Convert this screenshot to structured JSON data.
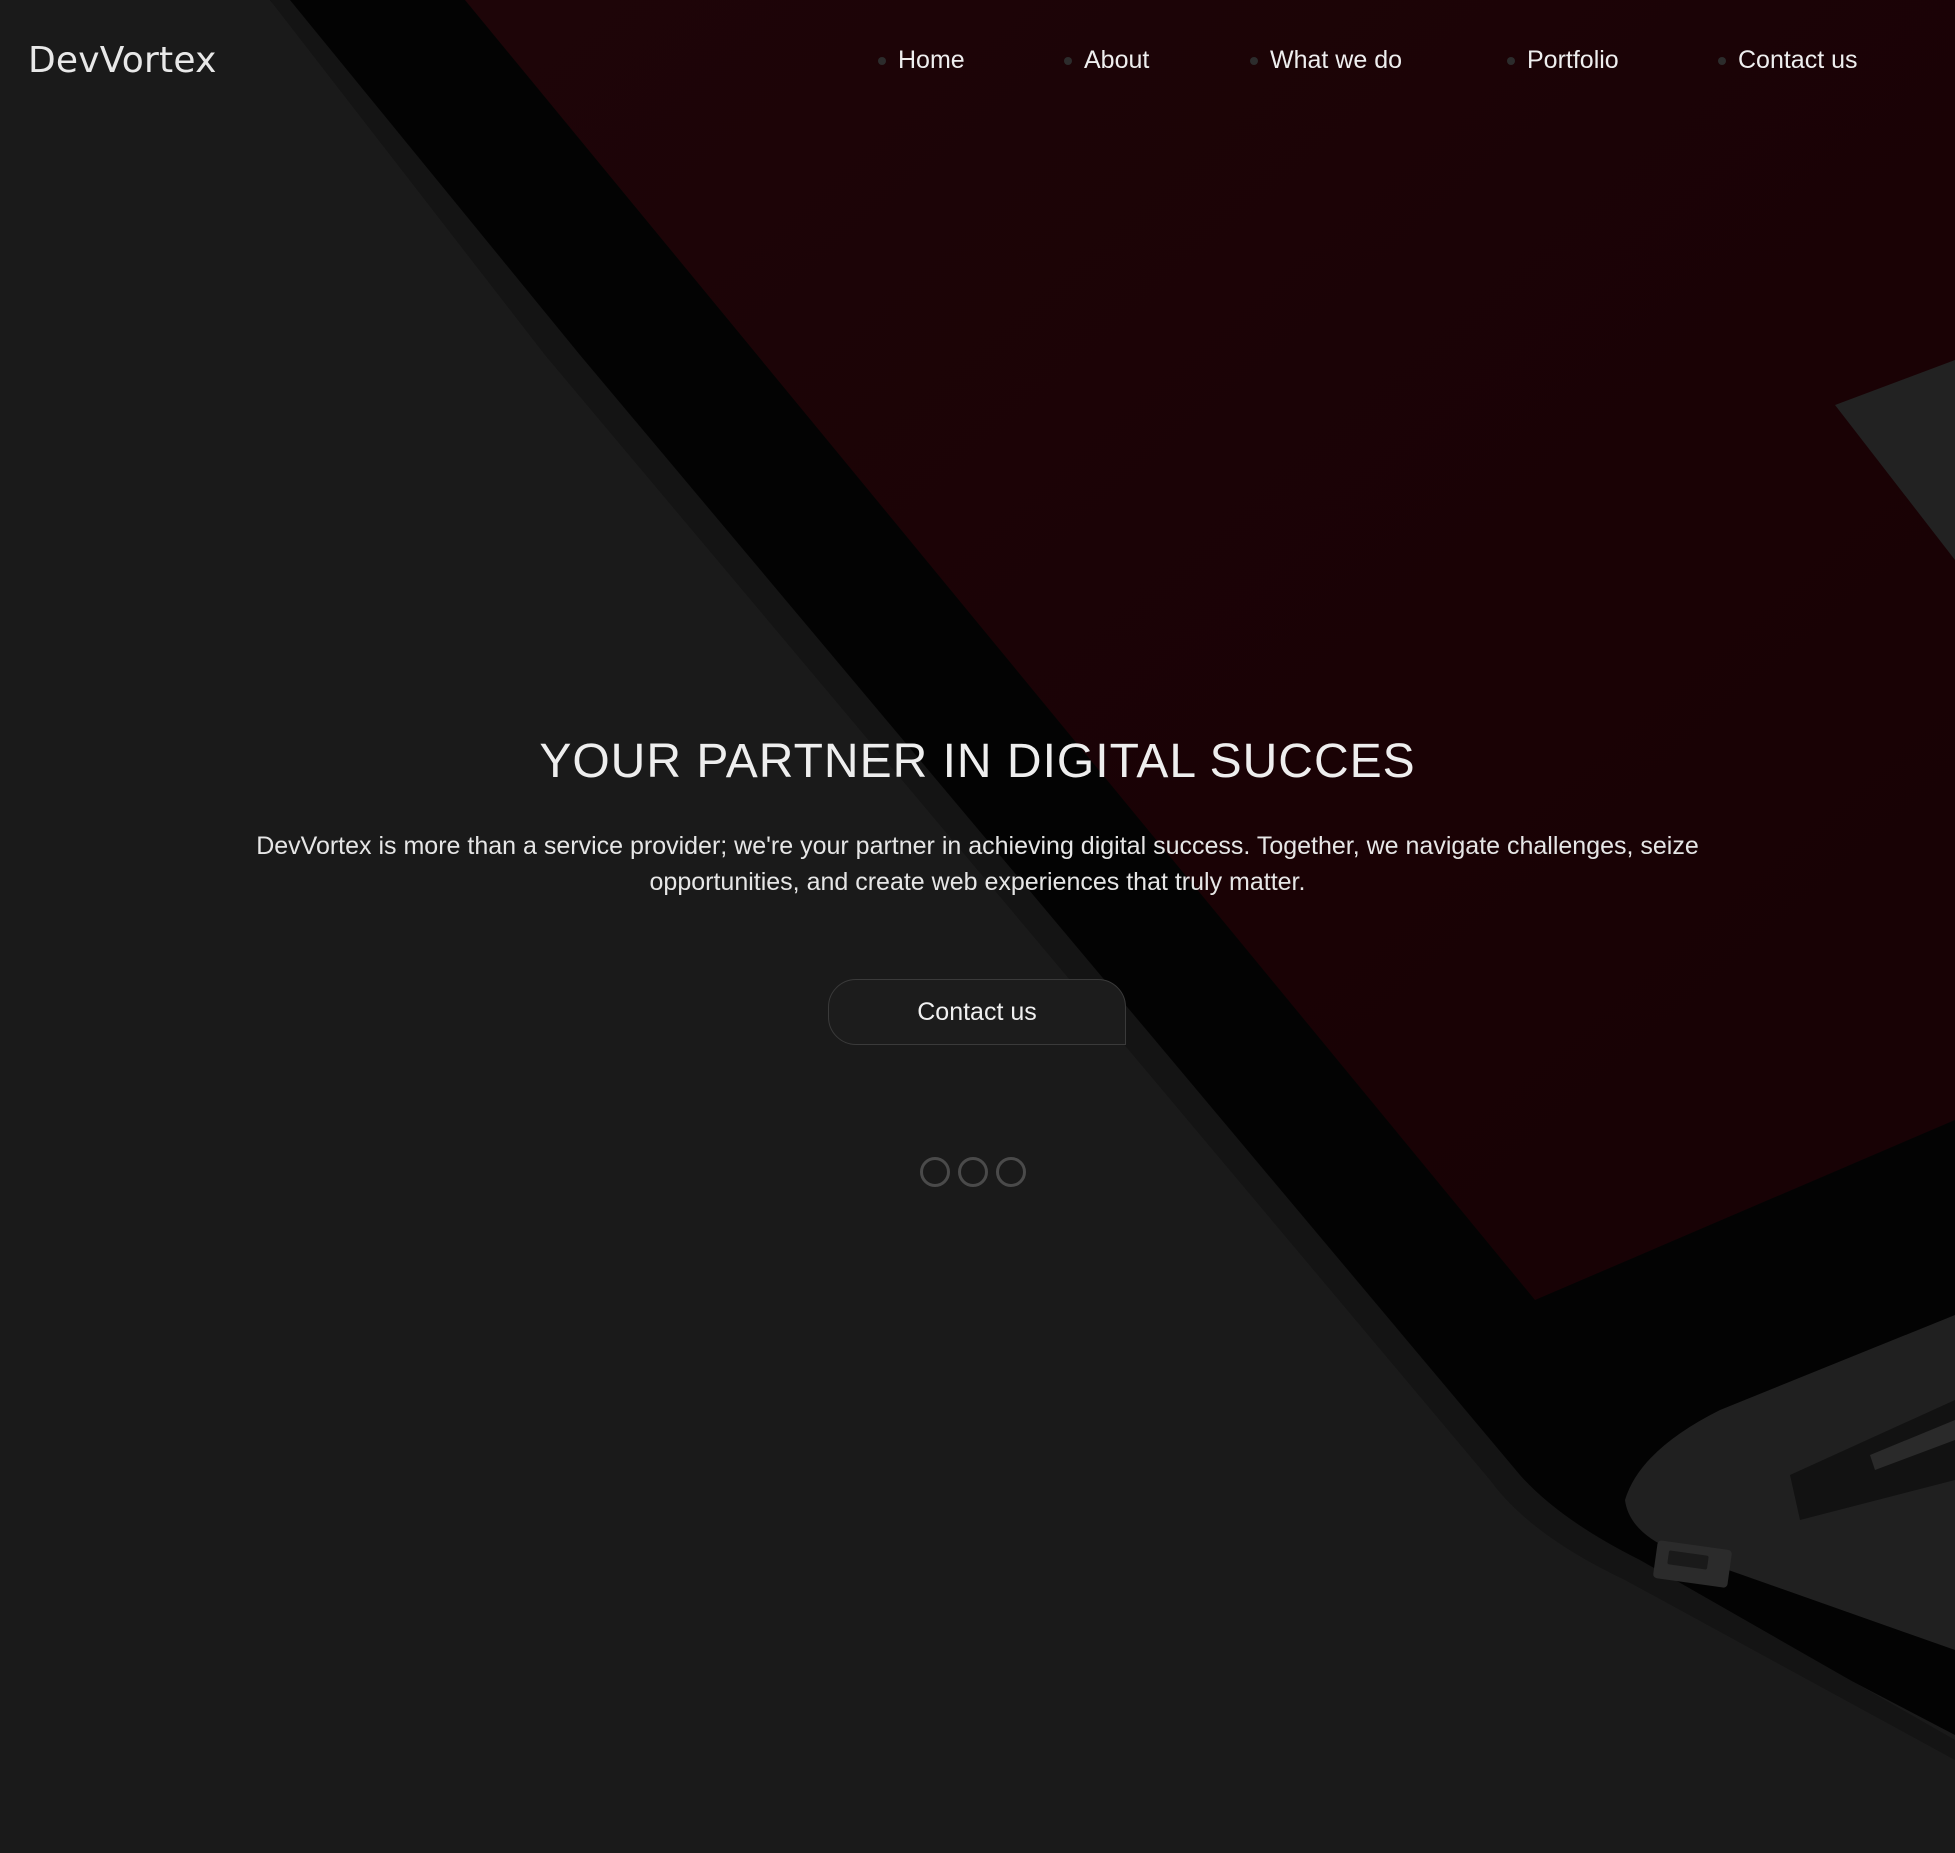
{
  "brand": {
    "logo_text": "DevVortex"
  },
  "nav": {
    "items": [
      {
        "label": "Home"
      },
      {
        "label": "About"
      },
      {
        "label": "What we do"
      },
      {
        "label": "Portfolio"
      },
      {
        "label": "Contact us"
      }
    ]
  },
  "hero": {
    "title": "YOUR PARTNER IN DIGITAL SUCCES",
    "description_line1": "DevVortex is more than a service provider; we're your partner in achieving digital success. Together, we navigate challenges, seize",
    "description_line2": "opportunities, and create web experiences that truly matter.",
    "cta_label": "Contact us"
  },
  "carousel": {
    "slide_count": 3
  },
  "colors": {
    "background": "#1a1a1a",
    "screen_accent": "#1c0306",
    "text": "#eeeeee"
  }
}
